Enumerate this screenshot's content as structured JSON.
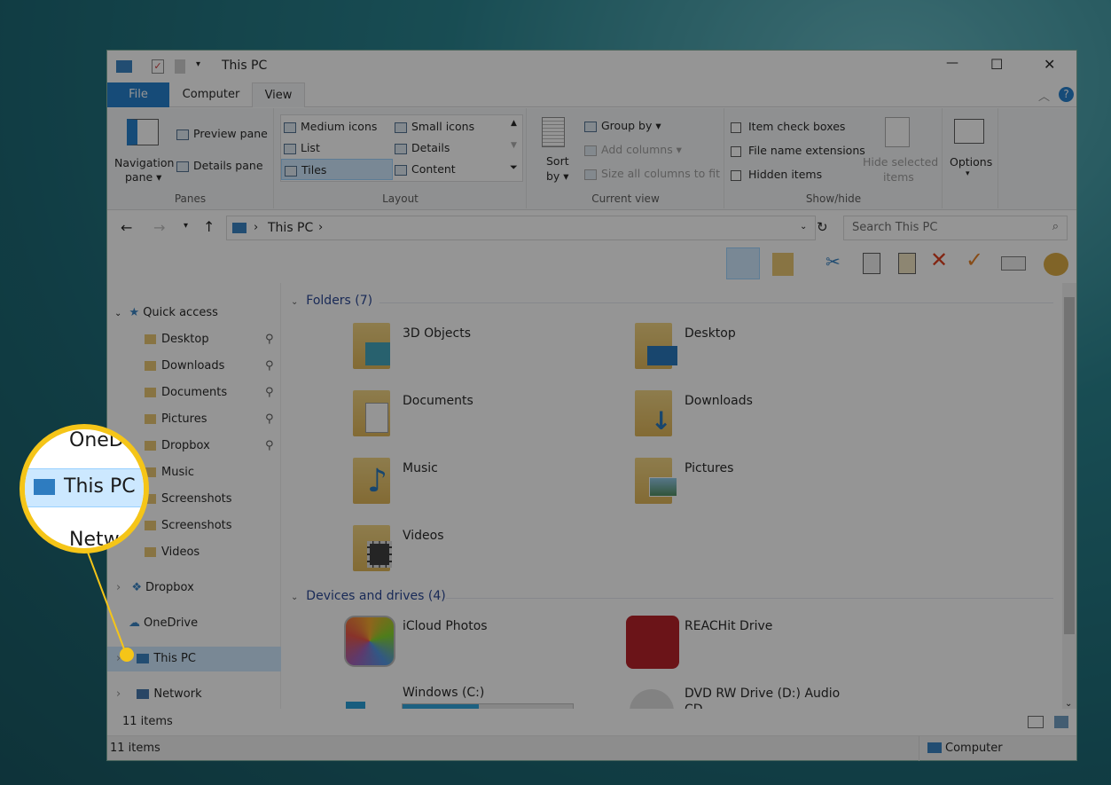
{
  "window": {
    "title": "This PC",
    "minimize": "—",
    "maximize": "☐",
    "close": "✕"
  },
  "tabs": [
    {
      "label": "File"
    },
    {
      "label": "Computer"
    },
    {
      "label": "View"
    }
  ],
  "ribbon": {
    "panes": {
      "label": "Panes",
      "navigation_pane": "Navigation",
      "navigation_pane2": "pane ▾",
      "preview_pane": "Preview pane",
      "details_pane": "Details pane"
    },
    "layout": {
      "label": "Layout",
      "items": [
        "Medium icons",
        "Small icons",
        "List",
        "Details",
        "Tiles",
        "Content"
      ],
      "selected": "Tiles"
    },
    "current_view": {
      "label": "Current view",
      "sort_by": "Sort",
      "sort_by2": "by ▾",
      "group_by": "Group by ▾",
      "add_columns": "Add columns ▾",
      "size_columns": "Size all columns to fit"
    },
    "show_hide": {
      "label": "Show/hide",
      "item_check_boxes": "Item check boxes",
      "file_name_extensions": "File name extensions",
      "hidden_items": "Hidden items",
      "hide_selected": "Hide selected",
      "hide_selected2": "items"
    },
    "options": {
      "label": "Options",
      "arrow": "▾"
    }
  },
  "address": {
    "path": "This PC",
    "search_placeholder": "Search This PC"
  },
  "nav": {
    "quick_access": "Quick access",
    "quick_items": [
      {
        "label": "Desktop",
        "pinned": true
      },
      {
        "label": "Downloads",
        "pinned": true
      },
      {
        "label": "Documents",
        "pinned": true
      },
      {
        "label": "Pictures",
        "pinned": true
      },
      {
        "label": "Dropbox",
        "pinned": true
      },
      {
        "label": "Music"
      },
      {
        "label": "Screenshots"
      },
      {
        "label": "Screenshots"
      },
      {
        "label": "Videos"
      }
    ],
    "roots": [
      {
        "label": "Dropbox"
      },
      {
        "label": "OneDrive"
      },
      {
        "label": "This PC",
        "selected": true
      },
      {
        "label": "Network"
      }
    ]
  },
  "content": {
    "folders_header": "Folders (7)",
    "folders": [
      "3D Objects",
      "Desktop",
      "Documents",
      "Downloads",
      "Music",
      "Pictures",
      "Videos"
    ],
    "devices_header": "Devices and drives (4)",
    "devices": [
      {
        "label": "iCloud Photos"
      },
      {
        "label": "REACHit Drive"
      },
      {
        "label": "Windows (C:)",
        "usage_percent": 45
      },
      {
        "label": "DVD RW Drive (D:) Audio CD"
      }
    ]
  },
  "status": {
    "items": "11 items",
    "items2": "11 items",
    "computer": "Computer"
  },
  "callout": {
    "top": "OneDrive",
    "middle": "This PC",
    "bottom": "Network",
    "accent": "#f5c518"
  }
}
